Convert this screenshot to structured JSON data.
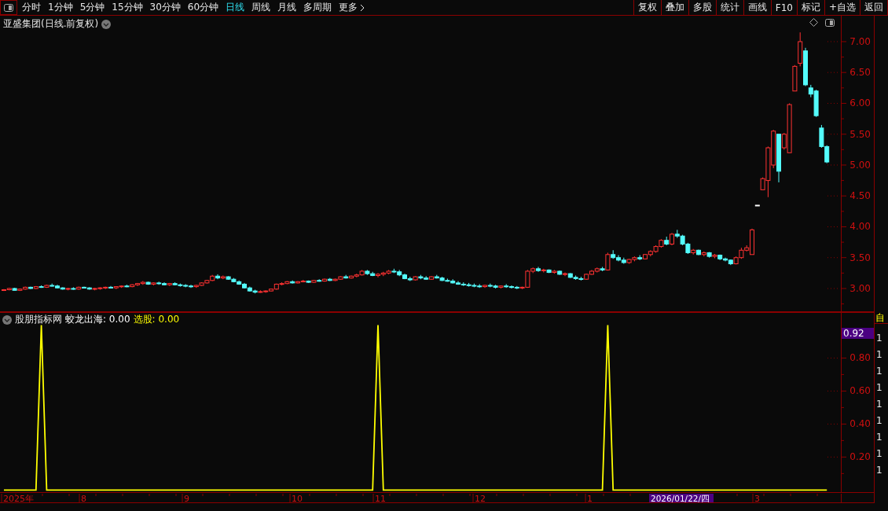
{
  "toolbar": {
    "periods": [
      {
        "label": "分时",
        "selected": false
      },
      {
        "label": "1分钟",
        "selected": false
      },
      {
        "label": "5分钟",
        "selected": false
      },
      {
        "label": "15分钟",
        "selected": false
      },
      {
        "label": "30分钟",
        "selected": false
      },
      {
        "label": "60分钟",
        "selected": false
      },
      {
        "label": "日线",
        "selected": true
      },
      {
        "label": "周线",
        "selected": false
      },
      {
        "label": "月线",
        "selected": false
      },
      {
        "label": "多周期",
        "selected": false
      },
      {
        "label": "更多",
        "selected": false,
        "kind": "menu"
      }
    ],
    "actions": [
      "复权",
      "叠加",
      "多股",
      "统计",
      "画线",
      "F10",
      "标记",
      "+自选",
      "返回"
    ]
  },
  "price_pane": {
    "title": "亚盛集团(日线.前复权)",
    "chart_data": {
      "type": "candlestick",
      "ylim": [
        2.63,
        7.42
      ],
      "yticks": [
        {
          "value": 7,
          "label": "7.00"
        },
        {
          "value": 6.5,
          "label": "6.50"
        },
        {
          "value": 6,
          "label": "6.00"
        },
        {
          "value": 5.5,
          "label": "5.50"
        },
        {
          "value": 5,
          "label": "5.00"
        },
        {
          "value": 4.5,
          "label": "4.50"
        },
        {
          "value": 4,
          "label": "4.00"
        },
        {
          "value": 3.5,
          "label": "3.50"
        },
        {
          "value": 3,
          "label": "3.00"
        }
      ],
      "ohlc": [
        [
          2.97,
          2.99,
          2.96,
          2.98
        ],
        [
          2.98,
          3.01,
          2.97,
          3.0
        ],
        [
          3.0,
          3.01,
          2.97,
          2.97
        ],
        [
          2.97,
          3.0,
          2.96,
          2.99
        ],
        [
          2.99,
          3.03,
          2.98,
          3.02
        ],
        [
          3.02,
          3.03,
          2.99,
          3.0
        ],
        [
          3.0,
          3.04,
          2.99,
          3.03
        ],
        [
          3.03,
          3.05,
          3.01,
          3.02
        ],
        [
          3.02,
          3.06,
          3.01,
          3.05
        ],
        [
          3.05,
          3.08,
          3.03,
          3.04
        ],
        [
          3.04,
          3.06,
          3.0,
          3.01
        ],
        [
          3.01,
          3.02,
          2.98,
          2.99
        ],
        [
          2.99,
          3.01,
          2.97,
          3.0
        ],
        [
          3.0,
          3.02,
          2.98,
          2.99
        ],
        [
          2.99,
          3.03,
          2.98,
          3.02
        ],
        [
          3.02,
          3.03,
          3.0,
          3.01
        ],
        [
          3.01,
          3.02,
          2.98,
          2.99
        ],
        [
          2.99,
          3.01,
          2.97,
          3.0
        ],
        [
          3.0,
          3.02,
          2.98,
          3.01
        ],
        [
          3.01,
          3.03,
          2.99,
          3.02
        ],
        [
          3.02,
          3.04,
          3.0,
          3.01
        ],
        [
          3.01,
          3.03,
          2.99,
          3.03
        ],
        [
          3.03,
          3.05,
          3.01,
          3.04
        ],
        [
          3.04,
          3.06,
          3.02,
          3.03
        ],
        [
          3.03,
          3.07,
          3.02,
          3.06
        ],
        [
          3.06,
          3.09,
          3.04,
          3.08
        ],
        [
          3.08,
          3.12,
          3.06,
          3.1
        ],
        [
          3.1,
          3.11,
          3.06,
          3.07
        ],
        [
          3.07,
          3.1,
          3.05,
          3.09
        ],
        [
          3.09,
          3.11,
          3.06,
          3.08
        ],
        [
          3.08,
          3.1,
          3.05,
          3.06
        ],
        [
          3.06,
          3.09,
          3.04,
          3.08
        ],
        [
          3.08,
          3.1,
          3.05,
          3.06
        ],
        [
          3.06,
          3.08,
          3.03,
          3.05
        ],
        [
          3.05,
          3.07,
          3.02,
          3.04
        ],
        [
          3.04,
          3.06,
          3.01,
          3.03
        ],
        [
          3.03,
          3.06,
          3.01,
          3.05
        ],
        [
          3.05,
          3.1,
          3.04,
          3.09
        ],
        [
          3.09,
          3.14,
          3.08,
          3.13
        ],
        [
          3.13,
          3.22,
          3.12,
          3.2
        ],
        [
          3.2,
          3.23,
          3.15,
          3.17
        ],
        [
          3.17,
          3.21,
          3.15,
          3.19
        ],
        [
          3.19,
          3.2,
          3.14,
          3.15
        ],
        [
          3.15,
          3.17,
          3.1,
          3.11
        ],
        [
          3.11,
          3.13,
          3.06,
          3.07
        ],
        [
          3.07,
          3.09,
          3.0,
          3.01
        ],
        [
          3.01,
          3.03,
          2.95,
          2.96
        ],
        [
          2.96,
          2.98,
          2.92,
          2.94
        ],
        [
          2.94,
          2.97,
          2.93,
          2.95
        ],
        [
          2.95,
          2.97,
          2.93,
          2.96
        ],
        [
          2.96,
          3.0,
          2.95,
          2.99
        ],
        [
          2.99,
          3.08,
          2.98,
          3.07
        ],
        [
          3.07,
          3.1,
          3.05,
          3.08
        ],
        [
          3.08,
          3.12,
          3.07,
          3.11
        ],
        [
          3.11,
          3.13,
          3.08,
          3.09
        ],
        [
          3.09,
          3.12,
          3.08,
          3.11
        ],
        [
          3.11,
          3.14,
          3.1,
          3.12
        ],
        [
          3.12,
          3.13,
          3.09,
          3.1
        ],
        [
          3.1,
          3.14,
          3.09,
          3.13
        ],
        [
          3.13,
          3.15,
          3.11,
          3.12
        ],
        [
          3.12,
          3.16,
          3.11,
          3.15
        ],
        [
          3.15,
          3.17,
          3.12,
          3.13
        ],
        [
          3.13,
          3.16,
          3.12,
          3.15
        ],
        [
          3.15,
          3.2,
          3.14,
          3.19
        ],
        [
          3.19,
          3.22,
          3.16,
          3.17
        ],
        [
          3.17,
          3.21,
          3.16,
          3.2
        ],
        [
          3.2,
          3.24,
          3.18,
          3.22
        ],
        [
          3.22,
          3.3,
          3.21,
          3.28
        ],
        [
          3.28,
          3.3,
          3.22,
          3.24
        ],
        [
          3.24,
          3.27,
          3.2,
          3.21
        ],
        [
          3.21,
          3.25,
          3.18,
          3.23
        ],
        [
          3.23,
          3.27,
          3.2,
          3.25
        ],
        [
          3.25,
          3.3,
          3.23,
          3.28
        ],
        [
          3.28,
          3.32,
          3.25,
          3.27
        ],
        [
          3.27,
          3.3,
          3.2,
          3.22
        ],
        [
          3.22,
          3.24,
          3.15,
          3.16
        ],
        [
          3.16,
          3.19,
          3.12,
          3.14
        ],
        [
          3.14,
          3.2,
          3.13,
          3.19
        ],
        [
          3.19,
          3.22,
          3.15,
          3.17
        ],
        [
          3.17,
          3.2,
          3.14,
          3.15
        ],
        [
          3.15,
          3.2,
          3.14,
          3.19
        ],
        [
          3.19,
          3.22,
          3.16,
          3.17
        ],
        [
          3.17,
          3.19,
          3.12,
          3.13
        ],
        [
          3.13,
          3.16,
          3.11,
          3.12
        ],
        [
          3.12,
          3.15,
          3.08,
          3.09
        ],
        [
          3.09,
          3.12,
          3.06,
          3.07
        ],
        [
          3.07,
          3.1,
          3.04,
          3.06
        ],
        [
          3.06,
          3.09,
          3.03,
          3.05
        ],
        [
          3.05,
          3.08,
          3.02,
          3.04
        ],
        [
          3.04,
          3.07,
          3.01,
          3.03
        ],
        [
          3.03,
          3.06,
          3.01,
          3.05
        ],
        [
          3.05,
          3.08,
          3.02,
          3.04
        ],
        [
          3.04,
          3.06,
          3.0,
          3.02
        ],
        [
          3.02,
          3.05,
          3.0,
          3.04
        ],
        [
          3.04,
          3.07,
          3.01,
          3.03
        ],
        [
          3.03,
          3.05,
          3.0,
          3.02
        ],
        [
          3.02,
          3.04,
          2.99,
          3.01
        ],
        [
          3.01,
          3.03,
          2.99,
          3.02
        ],
        [
          3.02,
          3.3,
          3.01,
          3.28
        ],
        [
          3.28,
          3.34,
          3.25,
          3.32
        ],
        [
          3.32,
          3.35,
          3.27,
          3.29
        ],
        [
          3.29,
          3.32,
          3.26,
          3.3
        ],
        [
          3.3,
          3.31,
          3.25,
          3.26
        ],
        [
          3.26,
          3.3,
          3.24,
          3.28
        ],
        [
          3.28,
          3.29,
          3.22,
          3.23
        ],
        [
          3.23,
          3.26,
          3.2,
          3.24
        ],
        [
          3.24,
          3.25,
          3.17,
          3.18
        ],
        [
          3.18,
          3.21,
          3.14,
          3.16
        ],
        [
          3.16,
          3.19,
          3.13,
          3.15
        ],
        [
          3.15,
          3.24,
          3.14,
          3.23
        ],
        [
          3.23,
          3.3,
          3.22,
          3.28
        ],
        [
          3.28,
          3.34,
          3.26,
          3.32
        ],
        [
          3.32,
          3.35,
          3.28,
          3.3
        ],
        [
          3.3,
          3.58,
          3.29,
          3.55
        ],
        [
          3.55,
          3.62,
          3.48,
          3.5
        ],
        [
          3.5,
          3.54,
          3.44,
          3.46
        ],
        [
          3.46,
          3.5,
          3.4,
          3.42
        ],
        [
          3.42,
          3.48,
          3.4,
          3.47
        ],
        [
          3.47,
          3.52,
          3.44,
          3.5
        ],
        [
          3.5,
          3.54,
          3.46,
          3.48
        ],
        [
          3.48,
          3.56,
          3.47,
          3.55
        ],
        [
          3.55,
          3.62,
          3.52,
          3.6
        ],
        [
          3.6,
          3.7,
          3.58,
          3.68
        ],
        [
          3.68,
          3.8,
          3.66,
          3.78
        ],
        [
          3.78,
          3.84,
          3.7,
          3.72
        ],
        [
          3.72,
          3.9,
          3.7,
          3.88
        ],
        [
          3.88,
          3.95,
          3.82,
          3.85
        ],
        [
          3.85,
          3.87,
          3.7,
          3.72
        ],
        [
          3.72,
          3.74,
          3.56,
          3.58
        ],
        [
          3.58,
          3.64,
          3.55,
          3.62
        ],
        [
          3.62,
          3.63,
          3.54,
          3.55
        ],
        [
          3.55,
          3.6,
          3.52,
          3.58
        ],
        [
          3.58,
          3.59,
          3.5,
          3.52
        ],
        [
          3.52,
          3.56,
          3.49,
          3.54
        ],
        [
          3.54,
          3.55,
          3.46,
          3.48
        ],
        [
          3.48,
          3.5,
          3.44,
          3.46
        ],
        [
          3.46,
          3.47,
          3.38,
          3.4
        ],
        [
          3.4,
          3.52,
          3.39,
          3.5
        ],
        [
          3.5,
          3.66,
          3.48,
          3.62
        ],
        [
          3.62,
          3.7,
          3.6,
          3.66
        ],
        [
          3.55,
          3.97,
          3.55,
          3.95
        ],
        [
          4.35,
          4.35,
          4.35,
          4.35
        ],
        [
          4.6,
          4.8,
          4.6,
          4.78
        ],
        [
          4.75,
          5.3,
          4.48,
          5.28
        ],
        [
          5.0,
          5.57,
          4.95,
          5.55
        ],
        [
          5.5,
          5.5,
          4.72,
          4.9
        ],
        [
          5.28,
          5.52,
          5.25,
          5.5
        ],
        [
          5.2,
          6.0,
          5.2,
          5.98
        ],
        [
          6.2,
          6.62,
          6.2,
          6.6
        ],
        [
          6.65,
          7.15,
          6.6,
          7.0
        ],
        [
          6.85,
          6.9,
          6.28,
          6.3
        ],
        [
          6.25,
          6.3,
          6.1,
          6.15
        ],
        [
          6.2,
          6.22,
          5.78,
          5.8
        ],
        [
          5.6,
          5.65,
          5.28,
          5.3
        ],
        [
          5.3,
          5.32,
          5.03,
          5.05
        ]
      ]
    }
  },
  "indicator_pane": {
    "name": "股朋指标网",
    "legend": [
      {
        "label": "蛟龙出海: 0.00",
        "color": "#ffffff"
      },
      {
        "label": "选股: 0.00",
        "color": "#ffff00"
      }
    ],
    "cursor_value": "0.92",
    "chart_data": {
      "type": "line",
      "ylim": [
        -0.015,
        1.076
      ],
      "categories": [
        null,
        null,
        null,
        null,
        null,
        null,
        null,
        null,
        null,
        null,
        null,
        null,
        null,
        null,
        null,
        null,
        null,
        null,
        null,
        null,
        null,
        null,
        null,
        null,
        null,
        null,
        null,
        null,
        null,
        null,
        null,
        null,
        null,
        null,
        null,
        null,
        null,
        null,
        null,
        null,
        null,
        null,
        null,
        null,
        null,
        null,
        null,
        null,
        null,
        null,
        null,
        null,
        null,
        null,
        null,
        null,
        null,
        null,
        null,
        null,
        null,
        null,
        null,
        null,
        null,
        null,
        null,
        null,
        null,
        null,
        null,
        null,
        null,
        null,
        null,
        null,
        null,
        null,
        null,
        null,
        null,
        null,
        null,
        null,
        null,
        null,
        null,
        null,
        null,
        null,
        null,
        null,
        null,
        null,
        null,
        null,
        null,
        null,
        null,
        null,
        null,
        null,
        null,
        null,
        null,
        null,
        null,
        null,
        null,
        null,
        null,
        null,
        null,
        null,
        null,
        null,
        null,
        null,
        null,
        null,
        null,
        null,
        null,
        null,
        null,
        null,
        null,
        null,
        null,
        null,
        null,
        null,
        null,
        null,
        null,
        null,
        null,
        null,
        null,
        null,
        null,
        null,
        null,
        null,
        null,
        null,
        null,
        null,
        null,
        null,
        null,
        null,
        null,
        null,
        null
      ],
      "yticks": [
        {
          "value": 0.2,
          "label": "0.20"
        },
        {
          "value": 0.4,
          "label": "0.40"
        },
        {
          "value": 0.6,
          "label": "0.60"
        },
        {
          "value": 0.8,
          "label": "0.80"
        }
      ],
      "series": [
        {
          "color": "#ffff00",
          "values": [
            0,
            0,
            0,
            0,
            0,
            0,
            0,
            1,
            0,
            0,
            0,
            0,
            0,
            0,
            0,
            0,
            0,
            0,
            0,
            0,
            0,
            0,
            0,
            0,
            0,
            0,
            0,
            0,
            0,
            0,
            0,
            0,
            0,
            0,
            0,
            0,
            0,
            0,
            0,
            0,
            0,
            0,
            0,
            0,
            0,
            0,
            0,
            0,
            0,
            0,
            0,
            0,
            0,
            0,
            0,
            0,
            0,
            0,
            0,
            0,
            0,
            0,
            0,
            0,
            0,
            0,
            0,
            0,
            0,
            0,
            1,
            0,
            0,
            0,
            0,
            0,
            0,
            0,
            0,
            0,
            0,
            0,
            0,
            0,
            0,
            0,
            0,
            0,
            0,
            0,
            0,
            0,
            0,
            0,
            0,
            0,
            0,
            0,
            0,
            0,
            0,
            0,
            0,
            0,
            0,
            0,
            0,
            0,
            0,
            0,
            0,
            0,
            0,
            1,
            0,
            0,
            0,
            0,
            0,
            0,
            0,
            0,
            0,
            0,
            0,
            0,
            0,
            0,
            0,
            0,
            0,
            0,
            0,
            0,
            0,
            0,
            0,
            0,
            0,
            0,
            0,
            0,
            0,
            0,
            0,
            0,
            0,
            0,
            0,
            0,
            0,
            0,
            0,
            0,
            0
          ]
        }
      ]
    }
  },
  "time_axis": {
    "labels": [
      "2025年",
      "8",
      "9",
      "10",
      "11",
      "12",
      "1",
      "3"
    ],
    "cursor_date": "2026/01/22/四"
  },
  "side_panel": {
    "header": "自",
    "values": [
      "1",
      "1",
      "1",
      "1",
      "1",
      "1",
      "1",
      "1",
      "1"
    ]
  }
}
